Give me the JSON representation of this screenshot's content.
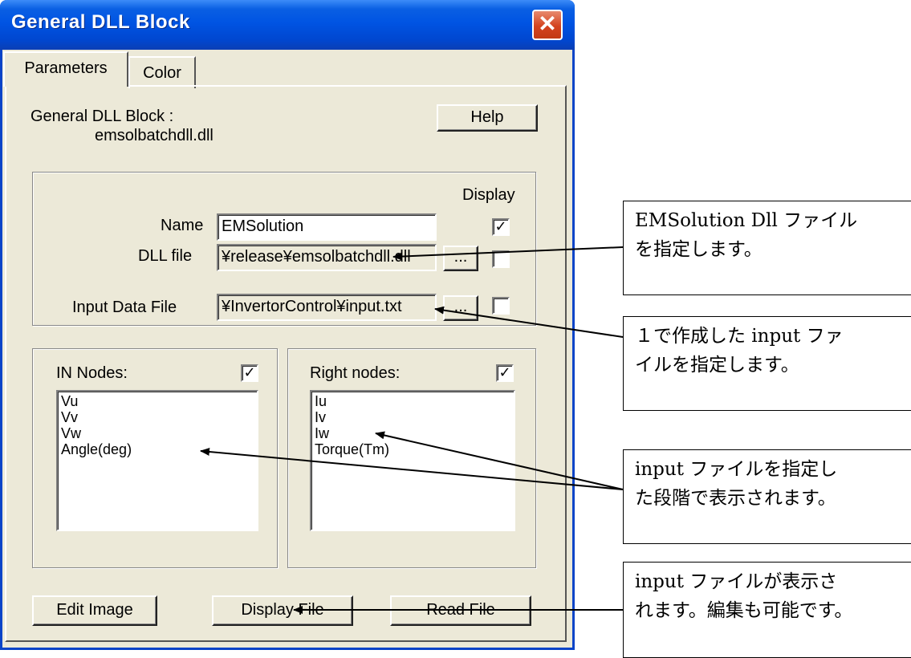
{
  "window": {
    "title": "General DLL Block",
    "close_glyph": "✕",
    "tabs": [
      {
        "label": "Parameters"
      },
      {
        "label": "Color"
      }
    ]
  },
  "panel": {
    "block_label": "General DLL Block :",
    "block_file": "emsolbatchdll.dll",
    "help_label": "Help",
    "display_label": "Display",
    "name_label": "Name",
    "name_value": "EMSolution",
    "dll_label": "DLL file",
    "dll_value": "¥release¥emsolbatchdll.dll",
    "input_label": "Input Data File",
    "input_value": "¥InvertorControl¥input.txt",
    "browse_label": "...",
    "in_nodes_label": "IN Nodes:",
    "in_nodes": [
      "Vu",
      "Vv",
      "Vw",
      "Angle(deg)"
    ],
    "right_nodes_label": "Right nodes:",
    "right_nodes": [
      "Iu",
      "Iv",
      "Iw",
      "Torque(Tm)"
    ],
    "edit_image_label": "Edit Image",
    "display_file_label": "Display File",
    "read_file_label": "Read File",
    "name_display_checked": true,
    "dll_display_checked": false,
    "input_display_checked": false,
    "in_nodes_checked": true,
    "right_nodes_checked": true
  },
  "callouts": [
    {
      "line1": "EMSolution Dll ファイル",
      "line2": "を指定します。"
    },
    {
      "line1": "１で作成した input ファ",
      "line2": "イルを指定します。"
    },
    {
      "line1": "input ファイルを指定し",
      "line2": "た段階で表示されます。"
    },
    {
      "line1": "input ファイルが表示さ",
      "line2": "れます。編集も可能です。"
    }
  ],
  "icons": {
    "close": "close-icon",
    "check": "checkmark-icon",
    "arrow": "arrow-icon"
  },
  "colors": {
    "titlebar": "#0054e3",
    "close": "#d4431f",
    "dialog_bg": "#ece9d8"
  }
}
